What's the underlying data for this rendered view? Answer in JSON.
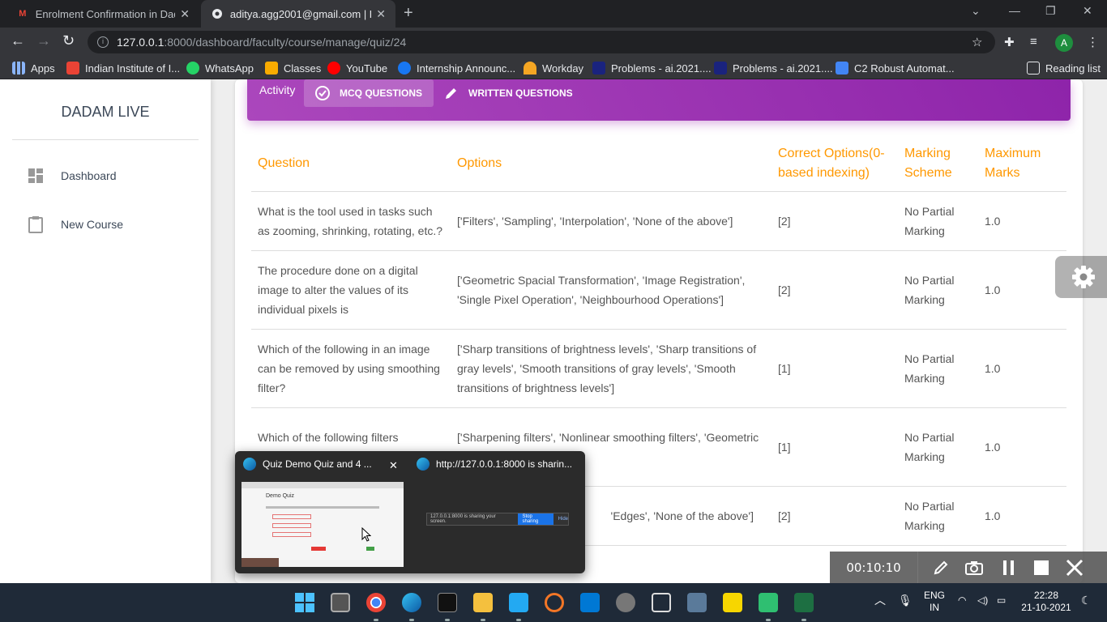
{
  "browser": {
    "tabs": [
      {
        "title": "Enrolment Confirmation in Dada",
        "icon": "gmail-icon"
      },
      {
        "title": "aditya.agg2001@gmail.com | Fac",
        "icon": "site-icon"
      }
    ],
    "url_host": "127.0.0.1",
    "url_rest": ":8000/dashboard/faculty/course/manage/quiz/24",
    "profile_initial": "A",
    "bookmarks": [
      "Apps",
      "Indian Institute of I...",
      "WhatsApp",
      "Classes",
      "YouTube",
      "Internship Announc...",
      "Workday",
      "Problems - ai.2021....",
      "Problems - ai.2021....",
      "C2 Robust Automat..."
    ],
    "reading_list": "Reading list"
  },
  "sidebar": {
    "brand": "DADAM LIVE",
    "items": [
      {
        "label": "Dashboard",
        "icon": "dashboard-icon"
      },
      {
        "label": "New Course",
        "icon": "clipboard-icon"
      }
    ]
  },
  "header": {
    "label": "Activity",
    "tabs": [
      {
        "label": "MCQ QUESTIONS",
        "icon": "quiz-icon",
        "active": true
      },
      {
        "label": "WRITTEN QUESTIONS",
        "icon": "pencil-icon",
        "active": false
      }
    ]
  },
  "table": {
    "columns": [
      "Question",
      "Options",
      "Correct Options(0-based indexing)",
      "Marking Scheme",
      "Maximum Marks"
    ],
    "rows": [
      {
        "question": "What is the tool used in tasks such as zooming, shrinking, rotating, etc.?",
        "options": "['Filters', 'Sampling', 'Interpolation', 'None of the above']",
        "correct": "[2]",
        "scheme": "No Partial Marking",
        "marks": "1.0"
      },
      {
        "question": "The procedure done on a digital image to alter the values of its individual pixels is",
        "options": "['Geometric Spacial Transformation', 'Image Registration', 'Single Pixel Operation', 'Neighbourhood Operations']",
        "correct": "[2]",
        "scheme": "No Partial Marking",
        "marks": "1.0"
      },
      {
        "question": "Which of the following in an image can be removed by using smoothing filter?",
        "options": "['Sharp transitions of brightness levels', 'Sharp transitions of gray levels', 'Smooth transitions of gray levels', 'Smooth transitions of brightness levels']",
        "correct": "[1]",
        "scheme": "No Partial Marking",
        "marks": "1.0"
      },
      {
        "question": "Which of the following filters response is based on ranking of",
        "options": "['Sharpening filters', 'Nonlinear smoothing filters', 'Geometric hing filters']",
        "correct": "[1]",
        "scheme": "No Partial Marking",
        "marks": "1.0"
      },
      {
        "question": "",
        "options": "'Edges', 'None of the above']",
        "correct": "[2]",
        "scheme": "No Partial Marking",
        "marks": "1.0"
      }
    ]
  },
  "popup": {
    "items": [
      {
        "title": "Quiz Demo Quiz and 4 ..."
      },
      {
        "title": "http://127.0.0.1:8000 is sharin..."
      }
    ],
    "thumb1_title": "Demo Quiz",
    "thumb2_text": "127.0.0.1:8000 is sharing your screen.",
    "thumb2_stop": "Stop sharing",
    "thumb2_hide": "Hide"
  },
  "recorder": {
    "time": "00:10:10"
  },
  "taskbar": {
    "lang_top": "ENG",
    "lang_bottom": "IN",
    "time": "22:28",
    "date": "21-10-2021"
  },
  "colors": {
    "accent": "#9c27b0",
    "header_text": "#ff9800"
  }
}
